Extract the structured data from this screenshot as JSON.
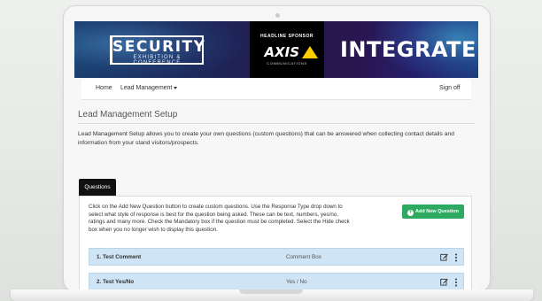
{
  "banner": {
    "event_title": "SECURITY",
    "event_subtitle": "EXHIBITION & CONFERENCE",
    "sponsor_label": "HEADLINE SPONSOR",
    "sponsor_name": "AXIS",
    "sponsor_sub": "COMMUNICATIONS",
    "integrate": "INTEGRATE"
  },
  "nav": {
    "home": "Home",
    "lead_management": "Lead Management",
    "sign_off": "Sign off"
  },
  "page": {
    "title": "Lead Management Setup",
    "intro": "Lead Management Setup allows you to create your own questions (custom questions) that can be answered when collecting contact details and information from your stand visitors/prospects."
  },
  "tabs": {
    "questions": "Questions"
  },
  "panel": {
    "instructions": "Click on the Add New Question button to create custom questions. Use the Response Type drop down to select what style of response is best for the question being asked. These can be text, numbers, yes/no, ratings and many more. Check the Mandatory box if the question must be completed. Select the Hide check box when you no longer wish to display this question.",
    "add_button": "Add New Question",
    "add_icon": "+"
  },
  "questions": [
    {
      "name": "1. Test Comment",
      "type": "Comment Box"
    },
    {
      "name": "2. Test Yes/No",
      "type": "Yes / No"
    }
  ],
  "icons": {
    "edit": "edit-icon",
    "more": "more-vertical-icon"
  },
  "colors": {
    "add_button": "#2daa5f",
    "question_row": "#cfe4f4",
    "tab_active": "#111111"
  }
}
